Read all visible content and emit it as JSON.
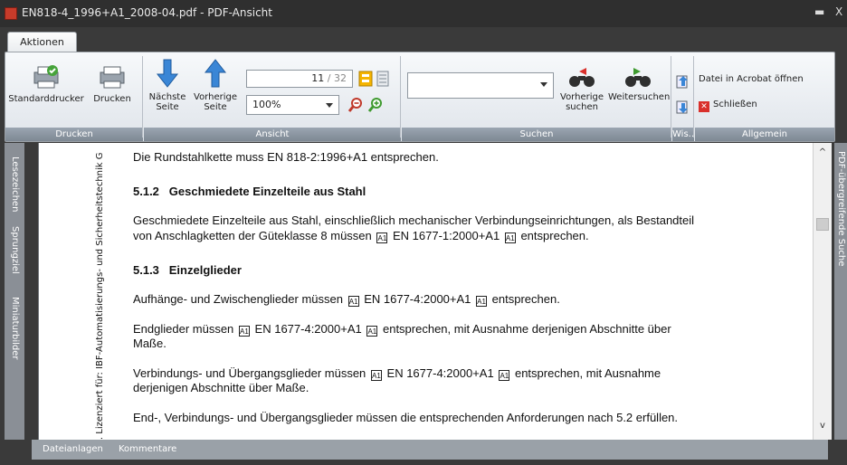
{
  "window": {
    "title": "EN818-4_1996+A1_2008-04.pdf - PDF-Ansicht",
    "minimize_glyph": "▬",
    "close_glyph": "X"
  },
  "ribbon": {
    "tab_label": "Aktionen",
    "groups": {
      "print": "Drucken",
      "page": "Ansicht",
      "search": "Suchen",
      "wis": "Wis...",
      "general": "Allgemein"
    },
    "buttons": {
      "standard_printer": "Standarddrucker",
      "print": "Drucken",
      "next_page_1": "Nächste",
      "next_page_2": "Seite",
      "prev_page_1": "Vorherige",
      "prev_page_2": "Seite",
      "search_prev_1": "Vorherige",
      "search_prev_2": "suchen",
      "search_next": "Weitersuchen",
      "open_acrobat": "Datei in Acrobat öffnen",
      "close": "Schließen"
    },
    "page_indicator": {
      "current": "11",
      "sep_total": "/ 32"
    },
    "zoom": "100%"
  },
  "side_tabs": {
    "bookmarks": "Lesezeichen",
    "jump_targets": "Sprungziel",
    "thumbnails": "Miniaturbilder",
    "right": "PDF-übergreifende Suche"
  },
  "document": {
    "watermark": "t. Lizenziert für: IBF-Automatisierungs- und Sicherheitstechnik G",
    "p1": "Die Rundstahlkette muss EN 818-2:1996+A1 entsprechen.",
    "h512_num": "5.1.2",
    "h512_text": "Geschmiedete Einzelteile aus Stahl",
    "p2a": "Geschmiedete Einzelteile aus Stahl, einschließlich mechanischer Verbindungseinrichtungen, als Bestandteil",
    "p2b_pre": "von Anschlagketten der Güteklasse 8 müssen",
    "p2b_post": "EN 1677-1:2000+A1",
    "p2b_end": "entsprechen.",
    "h513_num": "5.1.3",
    "h513_text": "Einzelglieder",
    "p3_pre": "Aufhänge- und Zwischenglieder müssen",
    "p3_post": "EN 1677-4:2000+A1",
    "p3_end": "entsprechen.",
    "p4_pre": "Endglieder müssen",
    "p4_post": "EN 1677-4:2000+A1",
    "p4_end": "entsprechen, mit Ausnahme derjenigen Abschnitte über",
    "p4b": "Maße.",
    "p5_pre": "Verbindungs- und Übergangsglieder müssen",
    "p5_post": "EN 1677-4:2000+A1",
    "p5_end": "entsprechen, mit Ausnahme",
    "p5b": "derjenigen Abschnitte über Maße.",
    "p6": "End-, Verbindungs- und Übergangsglieder müssen die entsprechenden Anforderungen nach 5.2 erfüllen.",
    "marker_open": "A1",
    "marker_close": "A1"
  },
  "statusbar": {
    "attachments": "Dateianlagen",
    "comments": "Kommentare"
  },
  "colors": {
    "accent": "#4a90d9",
    "ribbon_label": "#8a949e",
    "close_red": "#d9302b"
  }
}
